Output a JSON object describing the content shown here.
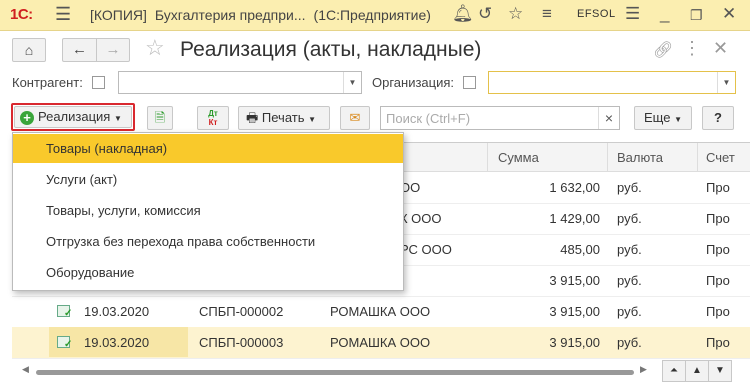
{
  "titlebar": {
    "logo": "1С:",
    "copy_label": "[КОПИЯ]",
    "app_name": "Бухгалтерия предпри...",
    "platform": "(1С:Предприятие)",
    "user": "EFSOL"
  },
  "header": {
    "title": "Реализация (акты, накладные)"
  },
  "filters": {
    "counterparty_label": "Контрагент:",
    "counterparty_value": "",
    "organization_label": "Организация:",
    "organization_value": ""
  },
  "toolbar": {
    "create_label": "Реализация",
    "print_label": "Печать",
    "search_placeholder": "Поиск (Ctrl+F)",
    "more_label": "Еще",
    "help_label": "?",
    "dtkt_top": "Дт",
    "dtkt_bottom": "Кт"
  },
  "dropdown_menu": {
    "items": [
      {
        "label": "Товары (накладная)",
        "active": true
      },
      {
        "label": "Услуги (акт)",
        "active": false
      },
      {
        "label": "Товары, услуги, комиссия",
        "active": false
      },
      {
        "label": "Отгрузка без перехода права собственности",
        "active": false
      },
      {
        "label": "Оборудование",
        "active": false
      }
    ]
  },
  "table": {
    "columns": [
      "Сумма",
      "Валюта",
      "Счет"
    ],
    "rows": [
      {
        "date": "",
        "number": "",
        "counterparty": "ОО",
        "sum": "1 632,00",
        "currency": "руб.",
        "account": "Про"
      },
      {
        "date": "",
        "number": "",
        "counterparty": "К ООО",
        "sum": "1 429,00",
        "currency": "руб.",
        "account": "Про"
      },
      {
        "date": "",
        "number": "",
        "counterparty": "РС ООО",
        "sum": "485,00",
        "currency": "руб.",
        "account": "Про"
      },
      {
        "date": "",
        "number": "",
        "counterparty": "",
        "sum": "3 915,00",
        "currency": "руб.",
        "account": "Про"
      },
      {
        "date": "19.03.2020",
        "number": "СПБП-000002",
        "counterparty": "РОМАШКА ООО",
        "sum": "3 915,00",
        "currency": "руб.",
        "account": "Про"
      },
      {
        "date": "19.03.2020",
        "number": "СПБП-000003",
        "counterparty": "РОМАШКА ООО",
        "sum": "3 915,00",
        "currency": "руб.",
        "account": "Про"
      }
    ]
  },
  "colors": {
    "titlebar_bg": "#fbeeb0",
    "menu_active": "#f9c92b",
    "selected_row": "#fdf3d0",
    "highlight_border": "#d9282f"
  }
}
